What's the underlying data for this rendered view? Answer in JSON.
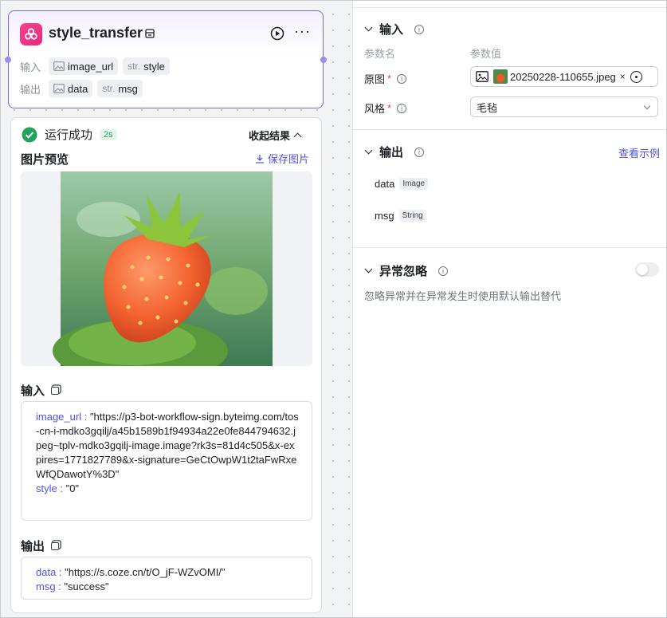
{
  "node": {
    "title": "style_transfer",
    "inputs_label": "输入",
    "outputs_label": "输出",
    "inputs": [
      {
        "prefix": "",
        "name": "image_url",
        "icon": "image-icon"
      },
      {
        "prefix": "str.",
        "name": "style"
      }
    ],
    "outputs": [
      {
        "prefix": "",
        "name": "data",
        "icon": "image-icon"
      },
      {
        "prefix": "str.",
        "name": "msg"
      }
    ]
  },
  "result": {
    "status": "运行成功",
    "duration": "2s",
    "collapse_label": "收起结果",
    "preview_title": "图片预览",
    "save_label": "保存图片",
    "input_title": "输入",
    "input_lines": {
      "image_url_key": "image_url",
      "image_url_value": "\"https://p3-bot-workflow-sign.byteimg.com/tos-cn-i-mdko3gqilj/a45b1589b1f94934a22e0fe844794632.jpeg~tplv-mdko3gqilj-image.image?rk3s=81d4c505&x-expires=1771827789&x-signature=GeCtOwpW1t2taFwRxeWfQDawotY%3D\"",
      "style_key": "style",
      "style_value": "\"0\""
    },
    "output_title": "输出",
    "output_lines": {
      "data_key": "data",
      "data_value": "\"https://s.coze.cn/t/O_jF-WZvOMI/\"",
      "msg_key": "msg",
      "msg_value": "\"success\""
    }
  },
  "panel": {
    "input_section": "输入",
    "col_param_name": "参数名",
    "col_param_value": "参数值",
    "fields": [
      {
        "label": "原图",
        "value": "20250228-110655.jpeg"
      },
      {
        "label": "风格",
        "value": "毛毡"
      }
    ],
    "output_section": "输出",
    "view_example": "查看示例",
    "outputs": [
      {
        "name": "data",
        "type": "Image"
      },
      {
        "name": "msg",
        "type": "String"
      }
    ],
    "exception_section": "异常忽略",
    "exception_desc": "忽略异常并在异常发生时使用默认输出替代",
    "exception_enabled": false
  },
  "colors": {
    "accent": "#4d53e8",
    "node_border": "#7768e8",
    "success": "#22a35a",
    "required": "#e23e3e"
  }
}
